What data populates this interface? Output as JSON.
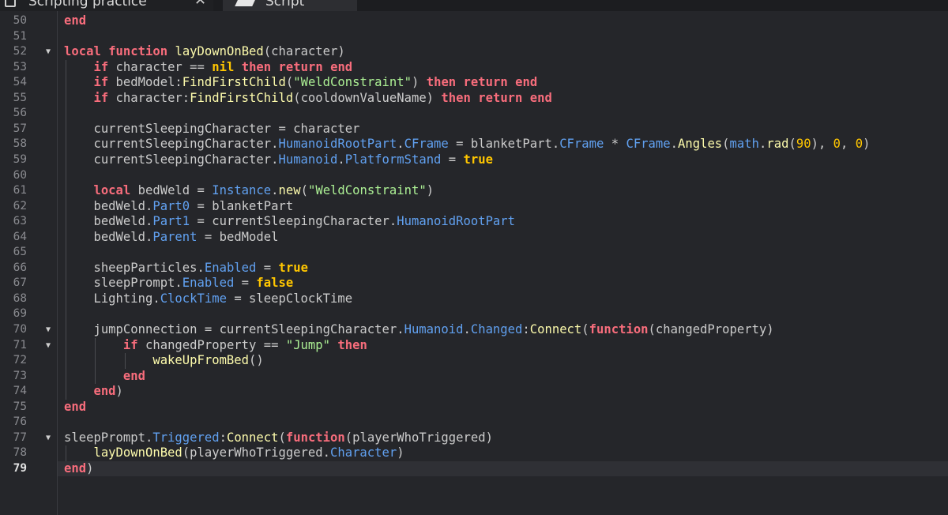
{
  "tabs": [
    {
      "label": "Scripting practice",
      "close": "✕"
    },
    {
      "label": "Script"
    }
  ],
  "editor": {
    "current_line": 79,
    "lines": [
      {
        "n": 50,
        "fold": false,
        "indent": 0,
        "tokens": [
          [
            "kw",
            "end"
          ]
        ]
      },
      {
        "n": 51,
        "fold": false,
        "indent": 0,
        "tokens": []
      },
      {
        "n": 52,
        "fold": true,
        "indent": 0,
        "tokens": [
          [
            "kw",
            "local"
          ],
          [
            "t",
            " "
          ],
          [
            "kw",
            "function"
          ],
          [
            "t",
            " "
          ],
          [
            "fn",
            "layDownOnBed"
          ],
          [
            "t",
            "(character)"
          ]
        ]
      },
      {
        "n": 53,
        "fold": false,
        "indent": 1,
        "tokens": [
          [
            "kw",
            "if"
          ],
          [
            "t",
            " character == "
          ],
          [
            "bi",
            "nil"
          ],
          [
            "t",
            " "
          ],
          [
            "kw",
            "then"
          ],
          [
            "t",
            " "
          ],
          [
            "kw",
            "return"
          ],
          [
            "t",
            " "
          ],
          [
            "kw",
            "end"
          ]
        ]
      },
      {
        "n": 54,
        "fold": false,
        "indent": 1,
        "tokens": [
          [
            "kw",
            "if"
          ],
          [
            "t",
            " bedModel:"
          ],
          [
            "fn",
            "FindFirstChild"
          ],
          [
            "t",
            "("
          ],
          [
            "str",
            "\"WeldConstraint\""
          ],
          [
            "t",
            ") "
          ],
          [
            "kw",
            "then"
          ],
          [
            "t",
            " "
          ],
          [
            "kw",
            "return"
          ],
          [
            "t",
            " "
          ],
          [
            "kw",
            "end"
          ]
        ]
      },
      {
        "n": 55,
        "fold": false,
        "indent": 1,
        "tokens": [
          [
            "kw",
            "if"
          ],
          [
            "t",
            " character:"
          ],
          [
            "fn",
            "FindFirstChild"
          ],
          [
            "t",
            "(cooldownValueName) "
          ],
          [
            "kw",
            "then"
          ],
          [
            "t",
            " "
          ],
          [
            "kw",
            "return"
          ],
          [
            "t",
            " "
          ],
          [
            "kw",
            "end"
          ]
        ]
      },
      {
        "n": 56,
        "fold": false,
        "indent": 0,
        "tokens": []
      },
      {
        "n": 57,
        "fold": false,
        "indent": 1,
        "tokens": [
          [
            "t",
            "currentSleepingCharacter = character"
          ]
        ]
      },
      {
        "n": 58,
        "fold": false,
        "indent": 1,
        "tokens": [
          [
            "t",
            "currentSleepingCharacter."
          ],
          [
            "prop",
            "HumanoidRootPart"
          ],
          [
            "t",
            "."
          ],
          [
            "prop",
            "CFrame"
          ],
          [
            "t",
            " = blanketPart."
          ],
          [
            "prop",
            "CFrame"
          ],
          [
            "t",
            " * "
          ],
          [
            "prop",
            "CFrame"
          ],
          [
            "t",
            "."
          ],
          [
            "fn",
            "Angles"
          ],
          [
            "t",
            "("
          ],
          [
            "prop",
            "math"
          ],
          [
            "t",
            "."
          ],
          [
            "fn",
            "rad"
          ],
          [
            "t",
            "("
          ],
          [
            "num",
            "90"
          ],
          [
            "t",
            "), "
          ],
          [
            "num",
            "0"
          ],
          [
            "t",
            ", "
          ],
          [
            "num",
            "0"
          ],
          [
            "t",
            ")"
          ]
        ]
      },
      {
        "n": 59,
        "fold": false,
        "indent": 1,
        "tokens": [
          [
            "t",
            "currentSleepingCharacter."
          ],
          [
            "prop",
            "Humanoid"
          ],
          [
            "t",
            "."
          ],
          [
            "prop",
            "PlatformStand"
          ],
          [
            "t",
            " = "
          ],
          [
            "bi",
            "true"
          ]
        ]
      },
      {
        "n": 60,
        "fold": false,
        "indent": 0,
        "tokens": []
      },
      {
        "n": 61,
        "fold": false,
        "indent": 1,
        "tokens": [
          [
            "kw",
            "local"
          ],
          [
            "t",
            " bedWeld = "
          ],
          [
            "prop",
            "Instance"
          ],
          [
            "t",
            "."
          ],
          [
            "fn",
            "new"
          ],
          [
            "t",
            "("
          ],
          [
            "str",
            "\"WeldConstraint\""
          ],
          [
            "t",
            ")"
          ]
        ]
      },
      {
        "n": 62,
        "fold": false,
        "indent": 1,
        "tokens": [
          [
            "t",
            "bedWeld."
          ],
          [
            "prop",
            "Part0"
          ],
          [
            "t",
            " = blanketPart"
          ]
        ]
      },
      {
        "n": 63,
        "fold": false,
        "indent": 1,
        "tokens": [
          [
            "t",
            "bedWeld."
          ],
          [
            "prop",
            "Part1"
          ],
          [
            "t",
            " = currentSleepingCharacter."
          ],
          [
            "prop",
            "HumanoidRootPart"
          ]
        ]
      },
      {
        "n": 64,
        "fold": false,
        "indent": 1,
        "tokens": [
          [
            "t",
            "bedWeld."
          ],
          [
            "prop",
            "Parent"
          ],
          [
            "t",
            " = bedModel"
          ]
        ]
      },
      {
        "n": 65,
        "fold": false,
        "indent": 0,
        "tokens": []
      },
      {
        "n": 66,
        "fold": false,
        "indent": 1,
        "tokens": [
          [
            "t",
            "sheepParticles."
          ],
          [
            "prop",
            "Enabled"
          ],
          [
            "t",
            " = "
          ],
          [
            "bi",
            "true"
          ]
        ]
      },
      {
        "n": 67,
        "fold": false,
        "indent": 1,
        "tokens": [
          [
            "t",
            "sleepPrompt."
          ],
          [
            "prop",
            "Enabled"
          ],
          [
            "t",
            " = "
          ],
          [
            "bi",
            "false"
          ]
        ]
      },
      {
        "n": 68,
        "fold": false,
        "indent": 1,
        "tokens": [
          [
            "t",
            "Lighting."
          ],
          [
            "prop",
            "ClockTime"
          ],
          [
            "t",
            " = sleepClockTime"
          ]
        ]
      },
      {
        "n": 69,
        "fold": false,
        "indent": 0,
        "tokens": []
      },
      {
        "n": 70,
        "fold": true,
        "indent": 1,
        "tokens": [
          [
            "t",
            "jumpConnection = currentSleepingCharacter."
          ],
          [
            "prop",
            "Humanoid"
          ],
          [
            "t",
            "."
          ],
          [
            "prop",
            "Changed"
          ],
          [
            "t",
            ":"
          ],
          [
            "fn",
            "Connect"
          ],
          [
            "t",
            "("
          ],
          [
            "kw",
            "function"
          ],
          [
            "t",
            "(changedProperty)"
          ]
        ]
      },
      {
        "n": 71,
        "fold": true,
        "indent": 2,
        "tokens": [
          [
            "kw",
            "if"
          ],
          [
            "t",
            " changedProperty == "
          ],
          [
            "str",
            "\"Jump\""
          ],
          [
            "t",
            " "
          ],
          [
            "kw",
            "then"
          ]
        ]
      },
      {
        "n": 72,
        "fold": false,
        "indent": 3,
        "tokens": [
          [
            "fn",
            "wakeUpFromBed"
          ],
          [
            "t",
            "()"
          ]
        ]
      },
      {
        "n": 73,
        "fold": false,
        "indent": 2,
        "tokens": [
          [
            "kw",
            "end"
          ]
        ]
      },
      {
        "n": 74,
        "fold": false,
        "indent": 1,
        "tokens": [
          [
            "kw",
            "end"
          ],
          [
            "t",
            ")"
          ]
        ]
      },
      {
        "n": 75,
        "fold": false,
        "indent": 0,
        "tokens": [
          [
            "kw",
            "end"
          ]
        ]
      },
      {
        "n": 76,
        "fold": false,
        "indent": 0,
        "tokens": []
      },
      {
        "n": 77,
        "fold": true,
        "indent": 0,
        "tokens": [
          [
            "t",
            "sleepPrompt."
          ],
          [
            "prop",
            "Triggered"
          ],
          [
            "t",
            ":"
          ],
          [
            "fn",
            "Connect"
          ],
          [
            "t",
            "("
          ],
          [
            "kw",
            "function"
          ],
          [
            "t",
            "(playerWhoTriggered)"
          ]
        ]
      },
      {
        "n": 78,
        "fold": false,
        "indent": 1,
        "tokens": [
          [
            "fn",
            "layDownOnBed"
          ],
          [
            "t",
            "(playerWhoTriggered."
          ],
          [
            "prop",
            "Character"
          ],
          [
            "t",
            ")"
          ]
        ]
      },
      {
        "n": 79,
        "fold": false,
        "indent": 0,
        "tokens": [
          [
            "kw",
            "end"
          ],
          [
            "t",
            ")"
          ]
        ]
      }
    ]
  },
  "colors": {
    "background": "#25262a",
    "keyword": "#f86d7c",
    "builtin": "#ffc600",
    "string": "#adf195",
    "number": "#ffc600",
    "property": "#61a1f1",
    "method": "#fdfbac",
    "text": "#cccccc"
  }
}
